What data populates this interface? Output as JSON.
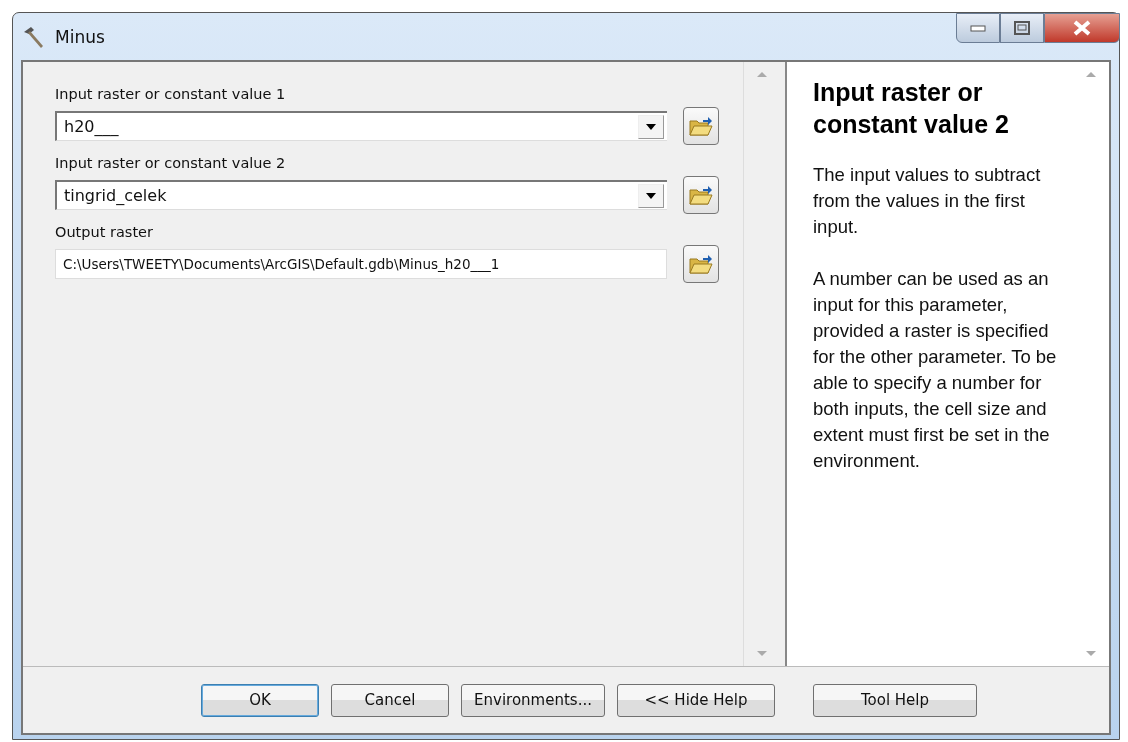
{
  "window": {
    "title": "Minus"
  },
  "parameters": [
    {
      "label": "Input raster or constant value 1",
      "value": "h20___",
      "kind": "dropdown"
    },
    {
      "label": "Input raster or constant value 2",
      "value": "tingrid_celek",
      "kind": "dropdown"
    },
    {
      "label": "Output raster",
      "value": "C:\\Users\\TWEETY\\Documents\\ArcGIS\\Default.gdb\\Minus_h20___1",
      "kind": "text"
    }
  ],
  "help": {
    "title": "Input raster or constant value 2",
    "paragraphs": [
      "The input values to subtract from the values in the first input.",
      "A number can be used as an input for this parameter, provided a raster is specified for the other parameter. To be able to specify a number for both inputs, the cell size and extent must first be set in the environment."
    ]
  },
  "buttons": [
    {
      "label": "OK",
      "default": true
    },
    {
      "label": "Cancel",
      "default": false
    },
    {
      "label": "Environments...",
      "default": false
    },
    {
      "label": "<< Hide Help",
      "default": false
    },
    {
      "label": "Tool Help",
      "default": false
    }
  ]
}
